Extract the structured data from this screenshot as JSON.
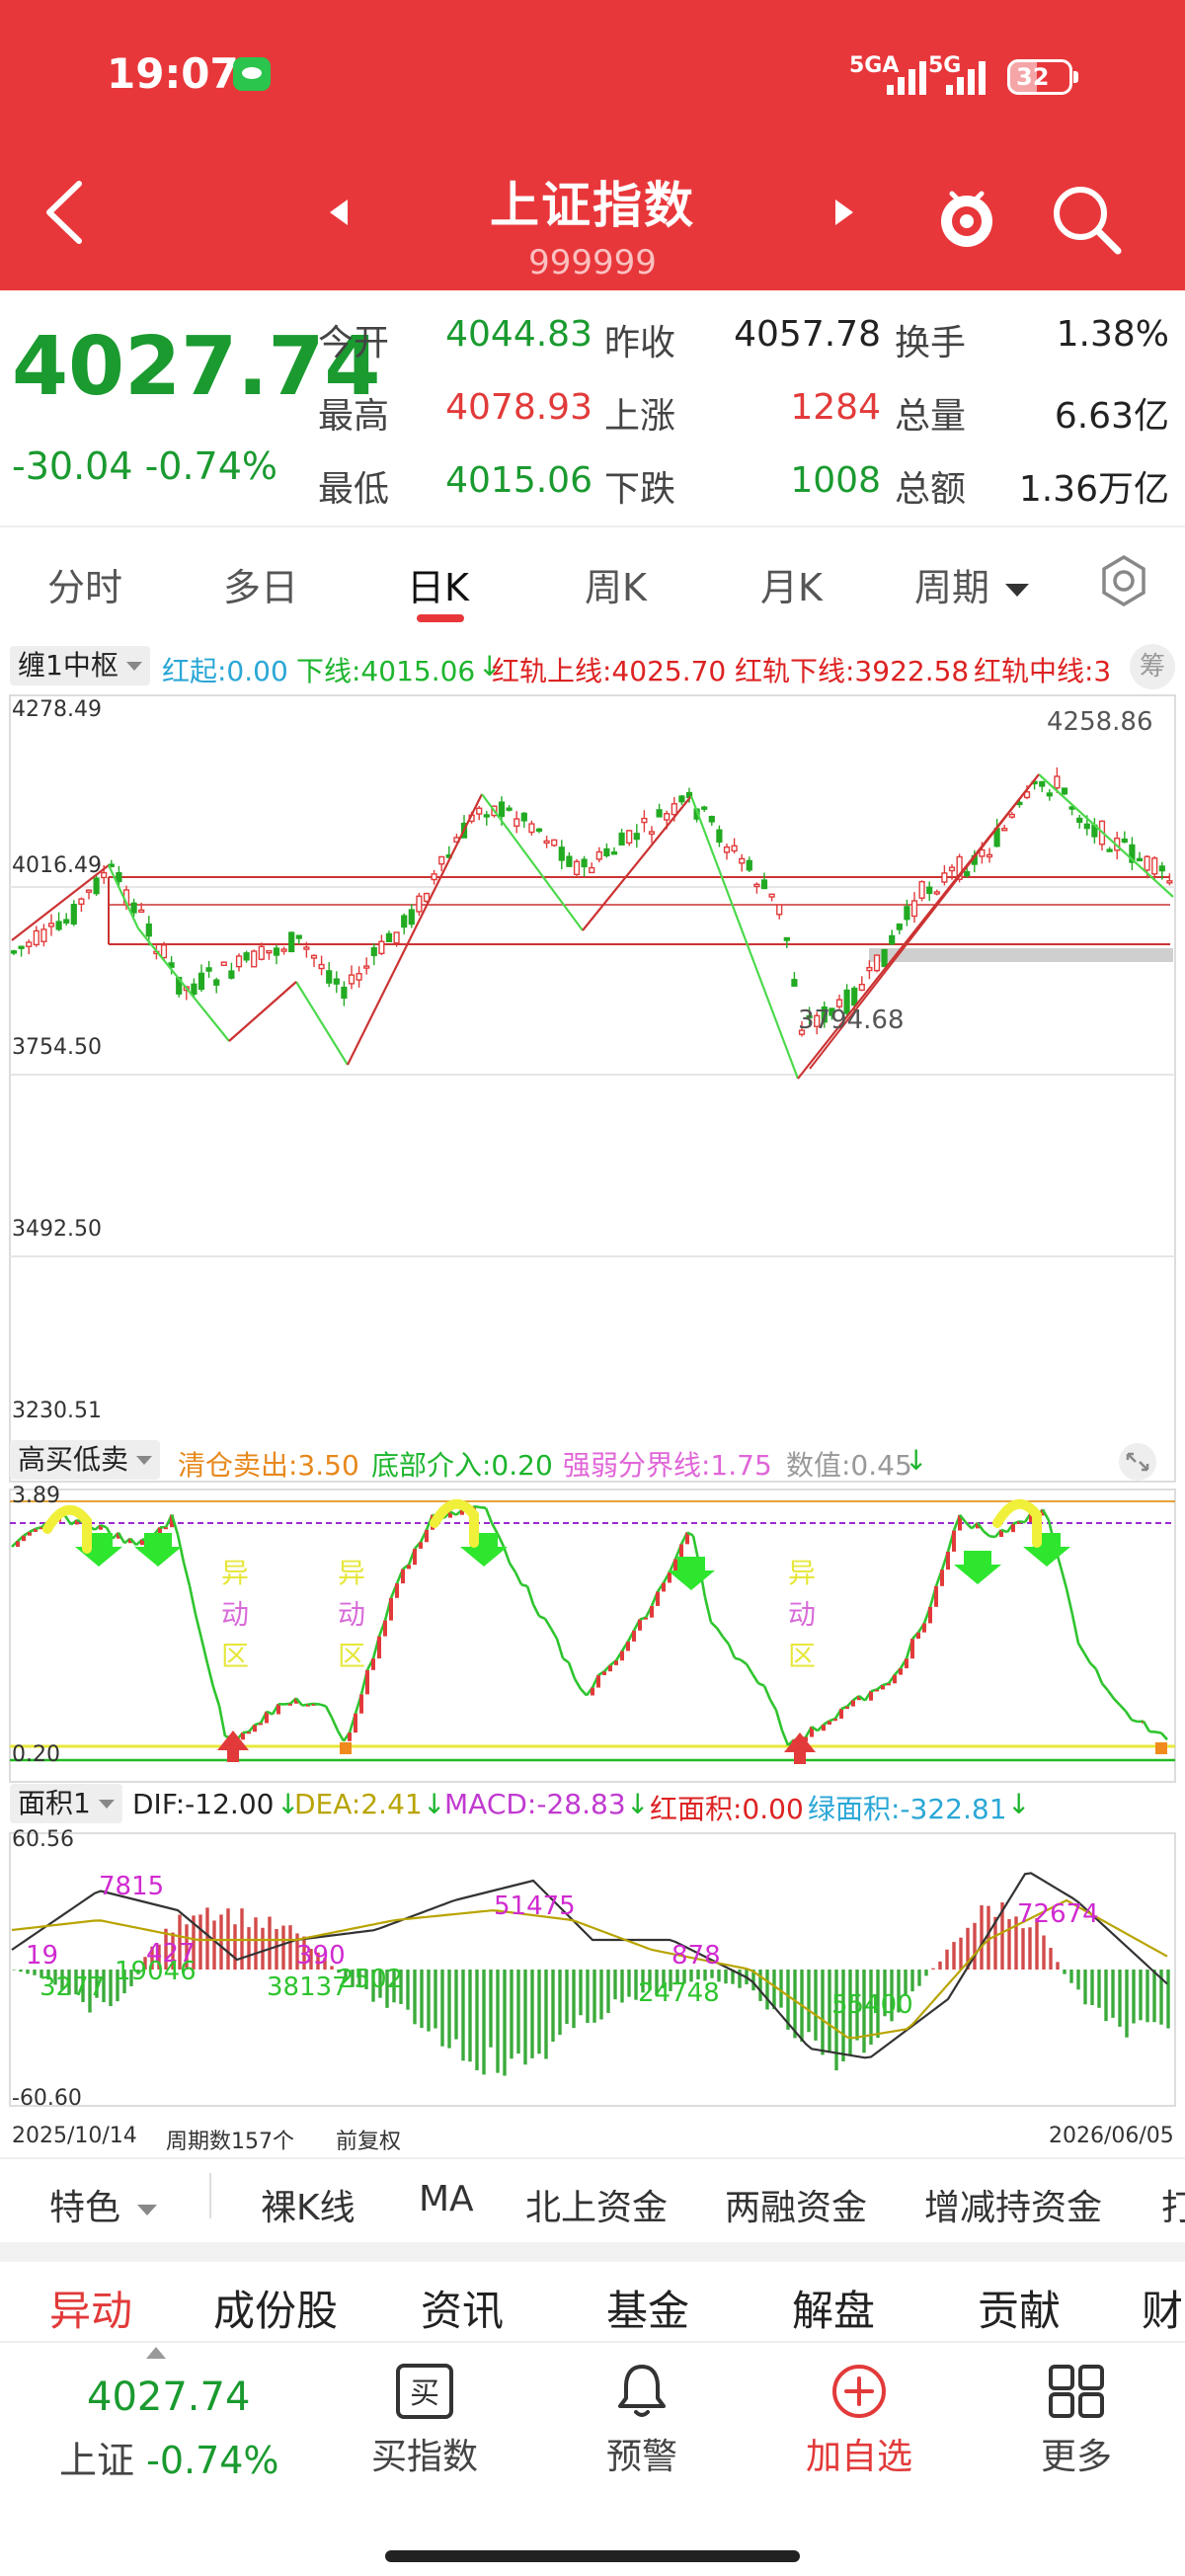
{
  "status_bar": {
    "time": "19:07",
    "signal1": "5GA",
    "signal2": "5G",
    "battery": "32"
  },
  "header": {
    "title": "上证指数",
    "code": "999999"
  },
  "quote": {
    "price": "4027.74",
    "change": "-30.04",
    "change_pct": "-0.74%",
    "rows": [
      {
        "l1": "今开",
        "v1": "4044.83",
        "l2": "昨收",
        "v2": "4057.78",
        "l3": "换手",
        "v3": "1.38%"
      },
      {
        "l1": "最高",
        "v1": "4078.93",
        "l2": "上涨",
        "v2": "1284",
        "l3": "总量",
        "v3": "6.63亿"
      },
      {
        "l1": "最低",
        "v1": "4015.06",
        "l2": "下跌",
        "v2": "1008",
        "l3": "总额",
        "v3": "1.36万亿"
      }
    ]
  },
  "tabs": [
    "分时",
    "多日",
    "日K",
    "周K",
    "月K",
    "周期"
  ],
  "main_chart": {
    "indicator": "缠1中枢",
    "hong_qi": "红起:0.00",
    "xia_xian": "下线:4015.06",
    "up_rail": "红轨上线:4025.70",
    "low_rail": "红轨下线:3922.58",
    "mid_rail": "红轨中线:3",
    "chip_label": "筹",
    "y_labels": [
      "4278.49",
      "4016.49",
      "3754.50",
      "3492.50",
      "3230.51"
    ],
    "annot_high": "4258.86",
    "annot_low": "3794.68"
  },
  "osc_chart": {
    "indicator": "高买低卖",
    "sell": "清仓卖出:3.50",
    "buy": "底部介入:0.20",
    "divide": "强弱分界线:1.75",
    "value": "数值:0.45",
    "y_top": "3.89",
    "y_bottom": "0.20",
    "zone_label": [
      "异",
      "动",
      "区"
    ]
  },
  "macd_chart": {
    "indicator": "面积1",
    "dif": "DIF:-12.00",
    "dea": "DEA:2.41",
    "macd": "MACD:-28.83",
    "red_area": "红面积:0.00",
    "green_area": "绿面积:-322.81",
    "y_top": "60.56",
    "y_bottom": "-60.60",
    "area_labels": [
      "7815",
      "51475",
      "878",
      "72674",
      "19",
      "427",
      "390",
      "3277",
      "19046",
      "38137",
      "2502",
      "24748",
      "55400"
    ]
  },
  "footer": {
    "start_date": "2025/10/14",
    "periods": "周期数157个",
    "adjust": "前复权",
    "end_date": "2026/06/05"
  },
  "features": [
    "特色",
    "裸K线",
    "MA",
    "北上资金",
    "两融资金",
    "增减持资金",
    "打"
  ],
  "news_tabs": [
    "异动",
    "成份股",
    "资讯",
    "基金",
    "解盘",
    "贡献",
    "财"
  ],
  "bottom": {
    "price": "4027.74",
    "name": "上证",
    "pct": "-0.74%",
    "items": [
      "买指数",
      "预警",
      "加自选",
      "更多"
    ],
    "buy_icon": "买"
  },
  "colors": {
    "brand": "#e8373b",
    "up": "#e23a3a",
    "down": "#1a9a2f",
    "green_line": "#2dd52d"
  }
}
